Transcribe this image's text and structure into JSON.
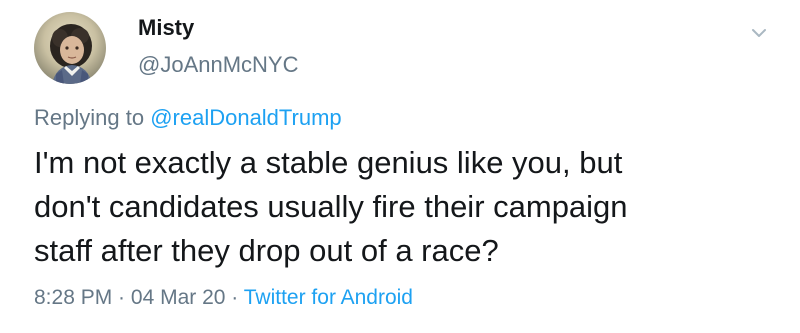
{
  "user": {
    "display_name": "Misty",
    "handle": "@JoAnnMcNYC",
    "avatar_icon": "profile-photo-avatar"
  },
  "menu": {
    "icon": "chevron-down-icon"
  },
  "reply": {
    "prefix": "Replying to ",
    "mention": "@realDonaldTrump"
  },
  "tweet": {
    "lines": [
      "I'm not exactly a stable genius like you, but",
      "don't candidates usually fire their campaign",
      "staff after they drop out of a race?"
    ]
  },
  "meta": {
    "time": "8:28 PM",
    "separator": " · ",
    "date": "04 Mar 20",
    "source": "Twitter for Android"
  },
  "colors": {
    "text": "#14171a",
    "secondary": "#657786",
    "link": "#1da1f2",
    "background": "#ffffff"
  }
}
